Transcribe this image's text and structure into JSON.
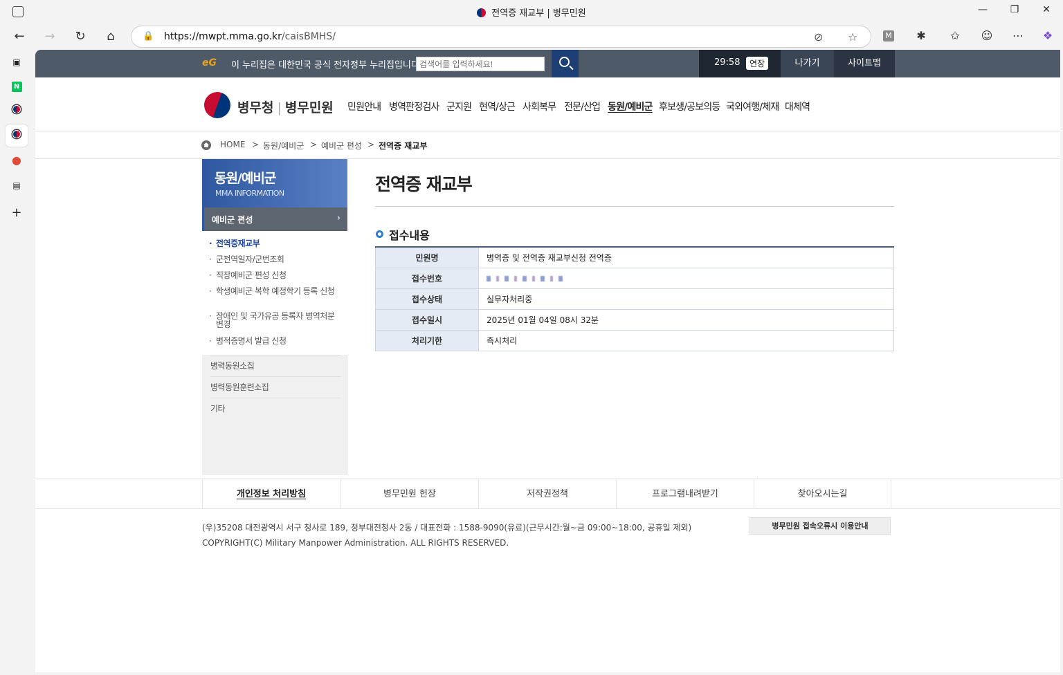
{
  "browser": {
    "tab_title": "전역증 재교부 | 병무민원",
    "url_host": "https://mwpt.mma.go.kr",
    "url_path": "/caisBMHS/",
    "ext_letter": "M"
  },
  "sidebar_icons": [
    "tabs-icon",
    "naver-icon",
    "mma-icon",
    "mma-icon-active",
    "maps-icon",
    "calendar-icon",
    "add-icon"
  ],
  "sidebar_naver_label": "N",
  "topbar": {
    "eg_logo": "eG",
    "gov_notice": "이 누리집은 대한민국 공식 전자정부 누리집입니다.",
    "search_placeholder": "검색어를 입력하세요!",
    "timer": "29:58",
    "extend_label": "연장",
    "exit_label": "나가기",
    "sitemap_label": "사이트맵"
  },
  "header": {
    "org_name": "병무청",
    "site_name": "병무민원",
    "nav": [
      "민원안내",
      "병역판정검사",
      "군지원",
      "현역/상근",
      "사회복무",
      "전문/산업",
      "동원/예비군",
      "후보생/공보의등",
      "국외여행/체재",
      "대체역"
    ],
    "active_nav": "동원/예비군"
  },
  "breadcrumb": {
    "items": [
      "HOME",
      ">",
      "동원/예비군",
      ">",
      "예비군 편성",
      ">",
      "전역증 재교부"
    ]
  },
  "lnb": {
    "title": "동원/예비군",
    "subtitle": "MMA INFORMATION",
    "selected": "예비군 편성",
    "sub_items": [
      "전역증재교부",
      "군전역일자/군번조회",
      "직장예비군 편성 신청",
      "학생예비군 복학 예정학기 등록 신청",
      "장애인 및 국가유공 등록자 병역처분변경",
      "병적증명서 발급 신청"
    ],
    "items": [
      "병력동원소집",
      "병력동원훈련소집",
      "기타"
    ]
  },
  "content": {
    "title": "전역증 재교부",
    "section_title": "접수내용",
    "rows": [
      {
        "label": "민원명",
        "value": "병역증 및 전역증 재교부신청  전역증"
      },
      {
        "label": "접수번호",
        "value": ""
      },
      {
        "label": "접수상태",
        "value": "실무자처리중"
      },
      {
        "label": "접수일시",
        "value": "2025년 01월 04일 08시 32분"
      },
      {
        "label": "처리기한",
        "value": "즉시처리"
      }
    ]
  },
  "footer": {
    "menu": [
      "개인정보 처리방침",
      "병무민원 헌장",
      "저작권정책",
      "프로그램내려받기",
      "찾아오시는길"
    ],
    "address": "(우)35208 대전광역시 서구 청사로 189, 정부대전청사 2동 / 대표전화 : 1588-9090(유료)(근무시간:월~금 09:00~18:00, 공휴일 제외)",
    "copyright": "COPYRIGHT(C) Military Manpower Administration. ALL RIGHTS RESERVED.",
    "guide_button": "병무민원 접속오류시 이용안내"
  }
}
